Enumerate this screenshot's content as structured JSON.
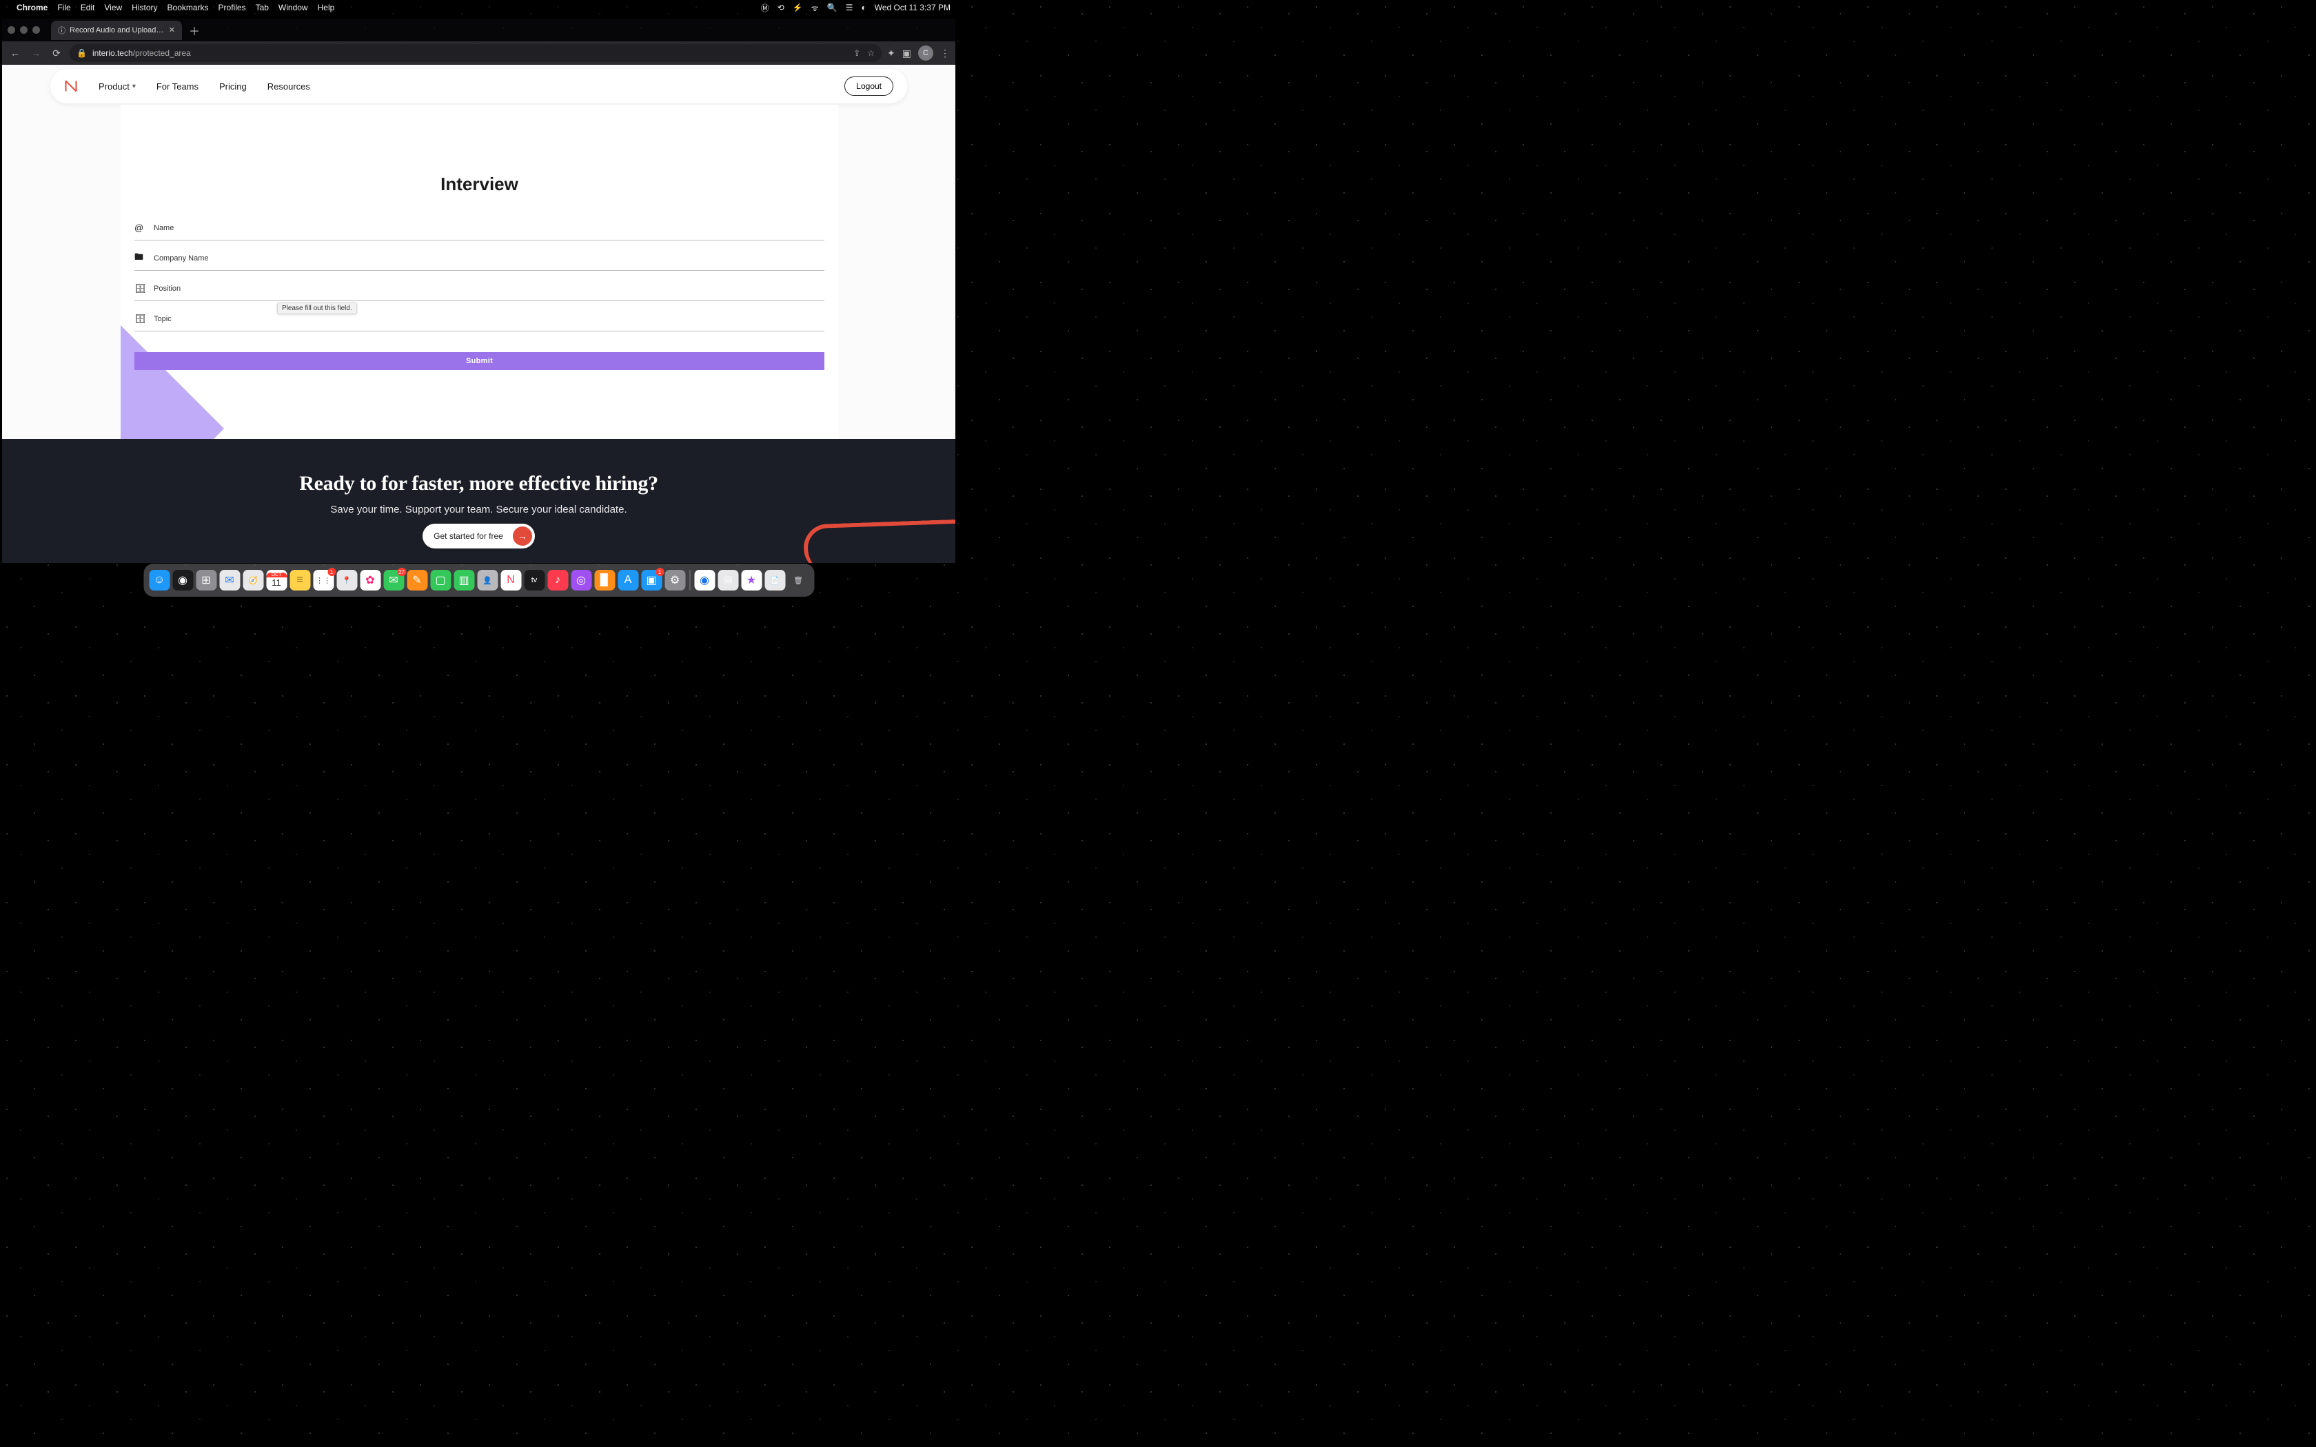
{
  "menubar": {
    "app": "Chrome",
    "items": [
      "File",
      "Edit",
      "View",
      "History",
      "Bookmarks",
      "Profiles",
      "Tab",
      "Window",
      "Help"
    ],
    "clock": "Wed Oct 11  3:37 PM"
  },
  "browser": {
    "tab_title": "Record Audio and Upload to E",
    "url_domain": "interio.tech",
    "url_path": "/protected_area",
    "avatar_letter": "C"
  },
  "nav": {
    "items": [
      "Product",
      "For Teams",
      "Pricing",
      "Resources"
    ],
    "logout": "Logout"
  },
  "form": {
    "title": "Interview",
    "fields": {
      "name": "Name",
      "company": "Company Name",
      "position": "Position",
      "topic": "Topic"
    },
    "submit": "Submit",
    "validation_msg": "Please fill out this field."
  },
  "footer": {
    "headline": "Ready to for faster, more effective hiring?",
    "sub": "Save your time. Support your team. Secure your ideal candidate.",
    "cta": "Get started for free"
  },
  "dock": {
    "items": [
      {
        "name": "finder",
        "bg": "#1e98f6",
        "glyph": "☺"
      },
      {
        "name": "siri",
        "bg": "#1b1b1d",
        "glyph": "◉"
      },
      {
        "name": "launchpad",
        "bg": "#8e8e93",
        "glyph": "⊞"
      },
      {
        "name": "mail",
        "bg": "#e8e8ea",
        "glyph": "✉",
        "fg": "#2b7ff3"
      },
      {
        "name": "safari",
        "bg": "#e8e8ea",
        "glyph": "🧭"
      },
      {
        "name": "calendar",
        "bg": "#fff",
        "glyph": "11",
        "fg": "#222",
        "top": "OCT"
      },
      {
        "name": "notes",
        "bg": "#ffd24a",
        "glyph": "≡",
        "fg": "#8a6b1a"
      },
      {
        "name": "reminders",
        "bg": "#fff",
        "glyph": "⋮⋮",
        "fg": "#555",
        "badge": "1"
      },
      {
        "name": "maps",
        "bg": "#e8e8ea",
        "glyph": "📍"
      },
      {
        "name": "photos",
        "bg": "#fff",
        "glyph": "✿",
        "fg": "#f27"
      },
      {
        "name": "messages",
        "bg": "#34c759",
        "glyph": "✉",
        "badge": "27"
      },
      {
        "name": "notes2",
        "bg": "#fd8e1c",
        "glyph": "✎"
      },
      {
        "name": "facetime",
        "bg": "#34c759",
        "glyph": "▢"
      },
      {
        "name": "numbers",
        "bg": "#34c759",
        "glyph": "▥"
      },
      {
        "name": "contacts",
        "bg": "#b9b9bd",
        "glyph": "👤"
      },
      {
        "name": "news",
        "bg": "#fff",
        "glyph": "N",
        "fg": "#ff3b58"
      },
      {
        "name": "tv",
        "bg": "#1b1b1d",
        "glyph": "tv"
      },
      {
        "name": "music",
        "bg": "#fc3c4e",
        "glyph": "♪"
      },
      {
        "name": "podcasts",
        "bg": "#a050f0",
        "glyph": "◎"
      },
      {
        "name": "books",
        "bg": "#fd8e1c",
        "glyph": "▉"
      },
      {
        "name": "appstore",
        "bg": "#1e98f6",
        "glyph": "A"
      },
      {
        "name": "zoom",
        "bg": "#1e98f6",
        "glyph": "▣",
        "badge": "1"
      },
      {
        "name": "settings",
        "bg": "#8e8e93",
        "glyph": "⚙"
      }
    ],
    "right": [
      {
        "name": "chrome",
        "bg": "#fff",
        "glyph": "◉",
        "fg": "#1a73e8"
      },
      {
        "name": "preview",
        "bg": "#e8e8ea",
        "glyph": "🖼"
      },
      {
        "name": "itunes",
        "bg": "#fff",
        "glyph": "★",
        "fg": "#a050f0"
      },
      {
        "name": "textedit",
        "bg": "#e8e8ea",
        "glyph": "📄"
      },
      {
        "name": "trash",
        "bg": "transparent",
        "glyph": "🗑",
        "fg": "#cfcfd3"
      }
    ]
  }
}
